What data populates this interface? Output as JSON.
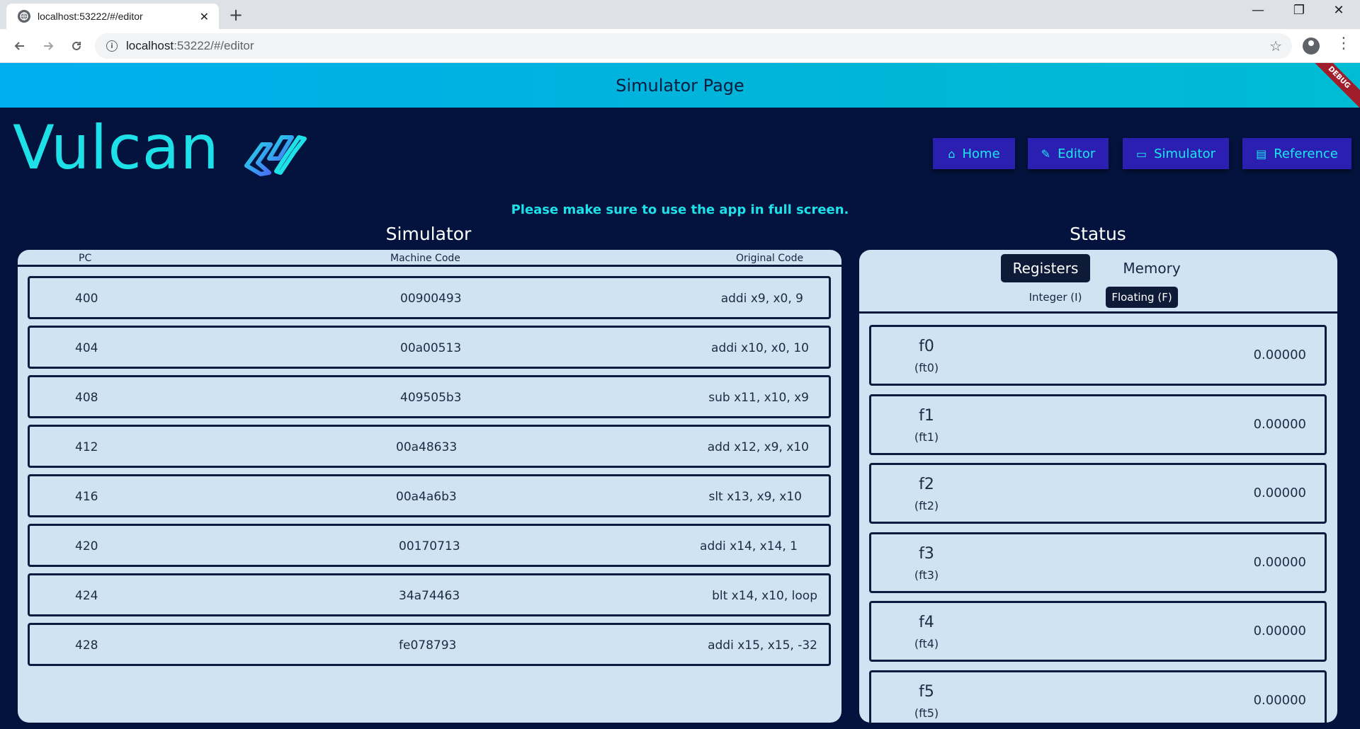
{
  "browser": {
    "tab_title": "localhost:53222/#/editor",
    "tab_close": "✕",
    "new_tab": "+",
    "url_host": "localhost",
    "url_rest": ":53222/#/editor",
    "window_controls": {
      "minimize": "—",
      "restore": "❐",
      "close": "✕"
    }
  },
  "appbar": {
    "title": "Simulator Page",
    "debug_banner": "DEBUG"
  },
  "logo": {
    "text": "Vulcan"
  },
  "nav": [
    {
      "label": "Home",
      "icon": "home-icon",
      "glyph": "⌂"
    },
    {
      "label": "Editor",
      "icon": "pencil-icon",
      "glyph": "✎"
    },
    {
      "label": "Simulator",
      "icon": "laptop-icon",
      "glyph": "▭"
    },
    {
      "label": "Reference",
      "icon": "library-books-icon",
      "glyph": "▤"
    }
  ],
  "notice": "Please make sure to use the app in full screen.",
  "simulator": {
    "title": "Simulator",
    "headers": {
      "pc": "PC",
      "machine": "Machine Code",
      "original": "Original Code"
    },
    "rows": [
      {
        "pc": "400",
        "machine": "00900493",
        "original": "addi x9, x0, 9"
      },
      {
        "pc": "404",
        "machine": "00a00513",
        "original": "addi x10, x0, 10"
      },
      {
        "pc": "408",
        "machine": "409505b3",
        "original": "sub x11, x10, x9"
      },
      {
        "pc": "412",
        "machine": "00a48633",
        "original": "add x12, x9, x10"
      },
      {
        "pc": "416",
        "machine": "00a4a6b3",
        "original": "slt x13, x9, x10"
      },
      {
        "pc": "420",
        "machine": "00170713",
        "original": "addi x14, x14, 1"
      },
      {
        "pc": "424",
        "machine": "34a74463",
        "original": "blt x14, x10, loop"
      },
      {
        "pc": "428",
        "machine": "fe078793",
        "original": "addi x15, x15, -32"
      }
    ]
  },
  "status": {
    "title": "Status",
    "tabs": {
      "registers": "Registers",
      "memory": "Memory"
    },
    "subtabs": {
      "integer": "Integer (I)",
      "floating": "Floating (F)"
    },
    "registers": [
      {
        "name": "f0",
        "alias": "(ft0)",
        "value": "0.00000"
      },
      {
        "name": "f1",
        "alias": "(ft1)",
        "value": "0.00000"
      },
      {
        "name": "f2",
        "alias": "(ft2)",
        "value": "0.00000"
      },
      {
        "name": "f3",
        "alias": "(ft3)",
        "value": "0.00000"
      },
      {
        "name": "f4",
        "alias": "(ft4)",
        "value": "0.00000"
      },
      {
        "name": "f5",
        "alias": "(ft5)",
        "value": "0.00000"
      }
    ]
  },
  "colors": {
    "background": "#03133d",
    "accent": "#1ee0e8",
    "nav_button": "#2a1fb0",
    "panel": "#cfe3f3"
  }
}
